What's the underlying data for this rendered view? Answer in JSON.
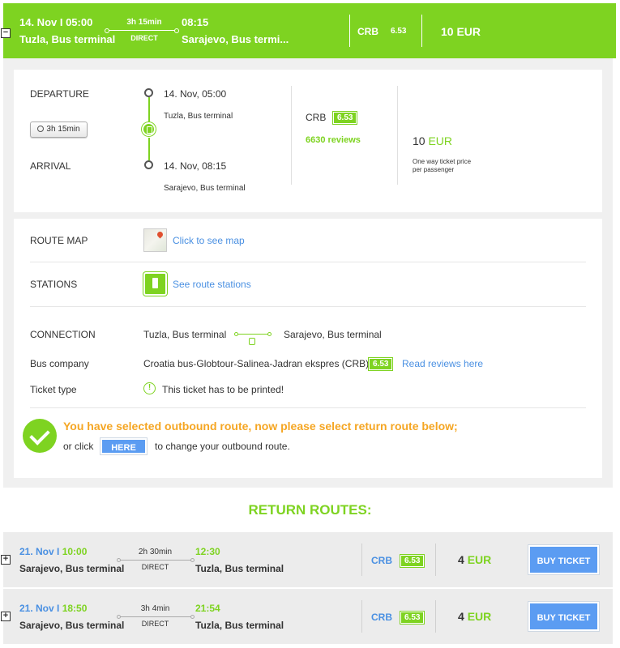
{
  "outbound": {
    "date_time": "14. Nov I 05:00",
    "from": "Tuzla, Bus terminal",
    "duration": "3h 15min",
    "direct": "DIRECT",
    "arrival_time": "08:15",
    "to": "Sarajevo, Bus termi...",
    "operator": "CRB",
    "rating": "6.53",
    "price": "10 EUR",
    "collapse_symbol": "−"
  },
  "details": {
    "departure_label": "DEPARTURE",
    "arrival_label": "ARRIVAL",
    "duration_pill": "3h 15min",
    "departure_datetime": "14. Nov, 05:00",
    "departure_station": "Tuzla, Bus terminal",
    "arrival_datetime": "14. Nov, 08:15",
    "arrival_station": "Sarajevo, Bus terminal",
    "operator": "CRB",
    "rating": "6.53",
    "reviews": "6630 reviews",
    "price_amount": "10",
    "price_currency": "EUR",
    "price_note_1": "One way ticket price",
    "price_note_2": "per passenger"
  },
  "extra": {
    "route_map_label": "ROUTE MAP",
    "route_map_link": "Click to see map",
    "stations_label": "STATIONS",
    "stations_link": "See route stations",
    "connection_label": "CONNECTION",
    "connection_from": "Tuzla, Bus terminal",
    "connection_to": "Sarajevo, Bus terminal",
    "bus_company_label": "Bus company",
    "bus_company": "Croatia bus-Globtour-Salinea-Jadran ekspres (CRB)",
    "bus_company_rating": "6.53",
    "reviews_link": "Read reviews here",
    "ticket_type_label": "Ticket type",
    "ticket_type_icon": "!",
    "ticket_type": "This ticket has to be printed!",
    "notice": "You have selected outbound route, now please select return route below;",
    "or_click": "or click",
    "here_button": "HERE",
    "change_text": "to change your outbound route."
  },
  "return_title": "RETURN ROUTES:",
  "return_routes": [
    {
      "date": "21. Nov I",
      "time": "10:00",
      "from": "Sarajevo, Bus terminal",
      "duration": "2h 30min",
      "direct": "DIRECT",
      "arrival_time": "12:30",
      "to": "Tuzla, Bus terminal",
      "operator": "CRB",
      "rating": "6.53",
      "price": "4",
      "currency": "EUR",
      "buy": "BUY TICKET",
      "expand_symbol": "+"
    },
    {
      "date": "21. Nov I",
      "time": "18:50",
      "from": "Sarajevo, Bus terminal",
      "duration": "3h 4min",
      "direct": "DIRECT",
      "arrival_time": "21:54",
      "to": "Tuzla, Bus terminal",
      "operator": "CRB",
      "rating": "6.53",
      "price": "4",
      "currency": "EUR",
      "buy": "BUY TICKET",
      "expand_symbol": "+"
    }
  ],
  "colors": {
    "green": "#7ed321",
    "blue": "#4a90e2",
    "button_blue": "#5b9cf2"
  }
}
